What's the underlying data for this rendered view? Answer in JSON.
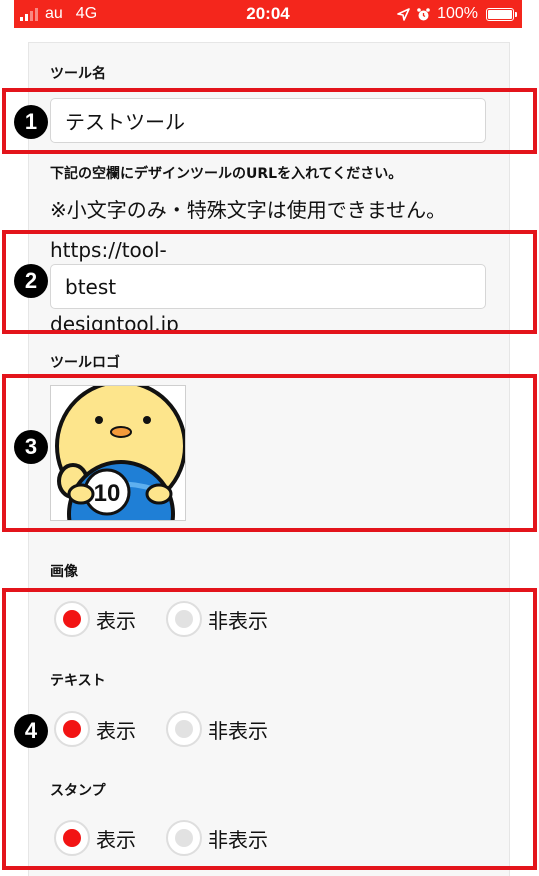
{
  "status_bar": {
    "carrier": "au",
    "network": "4G",
    "time": "20:04",
    "battery": "100%",
    "icons": [
      "signal-icon",
      "location-icon",
      "alarm-icon",
      "battery-icon"
    ]
  },
  "colors": {
    "status_bar_bg": "#f4261c",
    "annotation_red": "#e3141b",
    "radio_selected": "#f21414"
  },
  "form": {
    "tool_name_label": "ツール名",
    "tool_name_value": "テストツール",
    "url_instruction": "下記の空欄にデザインツールのURLを入れてください。",
    "url_note": "※小文字のみ・特殊文字は使用できません。",
    "url_prefix": "https://tool-",
    "url_value": "btest",
    "url_suffix": "designtool.jp",
    "logo_label": "ツールロゴ",
    "logo_text": "10",
    "sections": [
      {
        "label": "画像",
        "options": [
          "表示",
          "非表示"
        ],
        "selected": 0
      },
      {
        "label": "テキスト",
        "options": [
          "表示",
          "非表示"
        ],
        "selected": 0
      },
      {
        "label": "スタンプ",
        "options": [
          "表示",
          "非表示"
        ],
        "selected": 0
      }
    ]
  },
  "annotations": [
    "1",
    "2",
    "3",
    "4"
  ]
}
